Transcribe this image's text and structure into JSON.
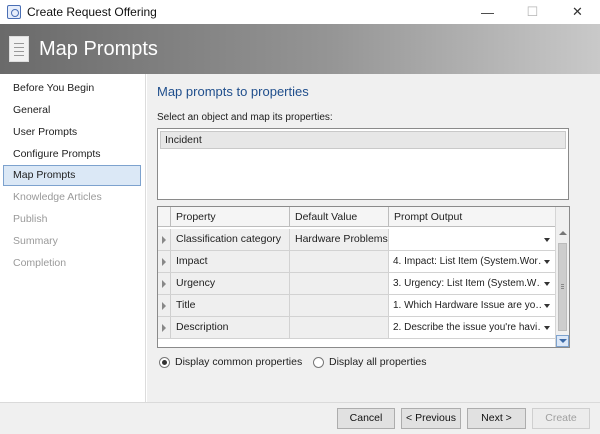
{
  "window": {
    "title": "Create Request Offering",
    "controls": {
      "minimize": "—",
      "maximize": "☐",
      "close": "✕"
    }
  },
  "banner": {
    "title": "Map Prompts",
    "icon": "document-icon"
  },
  "nav": {
    "items": [
      {
        "label": "Before You Begin",
        "state": "normal"
      },
      {
        "label": "General",
        "state": "normal"
      },
      {
        "label": "User Prompts",
        "state": "normal"
      },
      {
        "label": "Configure Prompts",
        "state": "normal"
      },
      {
        "label": "Map Prompts",
        "state": "active"
      },
      {
        "label": "Knowledge Articles",
        "state": "disabled"
      },
      {
        "label": "Publish",
        "state": "disabled"
      },
      {
        "label": "Summary",
        "state": "disabled"
      },
      {
        "label": "Completion",
        "state": "disabled"
      }
    ]
  },
  "main": {
    "heading": "Map prompts to properties",
    "object_prompt": "Select an object and map its properties:",
    "objects": [
      "Incident"
    ],
    "grid": {
      "columns": [
        "Property",
        "Default Value",
        "Prompt Output"
      ],
      "rows": [
        {
          "property": "Classification category",
          "default": "Hardware Problems",
          "output": ""
        },
        {
          "property": "Impact",
          "default": "",
          "output": "4. Impact: List Item (System.Wor…"
        },
        {
          "property": "Urgency",
          "default": "",
          "output": "3. Urgency: List Item (System.W…"
        },
        {
          "property": "Title",
          "default": "",
          "output": "1. Which Hardware Issue are yo…"
        },
        {
          "property": "Description",
          "default": "",
          "output": "2. Describe the issue you're havi…"
        }
      ]
    },
    "options": {
      "common": "Display common properties",
      "all": "Display all properties",
      "selected": "common"
    }
  },
  "footer": {
    "cancel": "Cancel",
    "previous": "< Previous",
    "next": "Next >",
    "create": "Create"
  }
}
